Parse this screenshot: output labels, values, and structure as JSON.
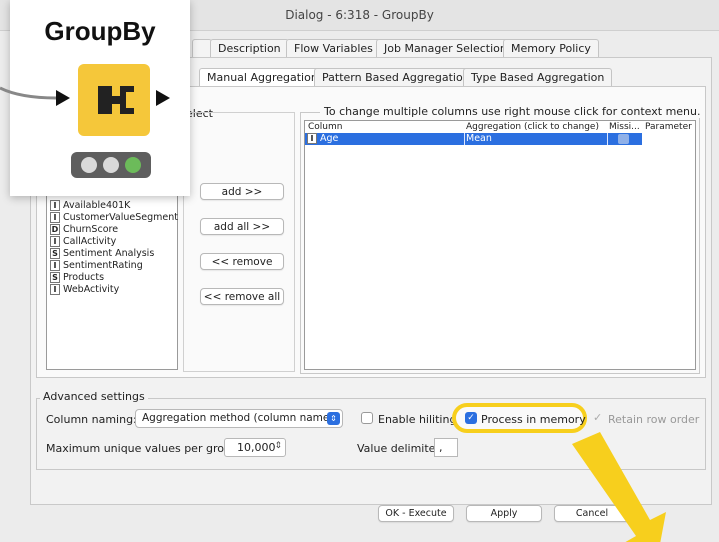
{
  "window": {
    "title": "Dialog - 6:318 - GroupBy"
  },
  "node": {
    "name": "GroupBy",
    "status_colors": [
      "#d9d9d9",
      "#d9d9d9",
      "#6cbb5a"
    ],
    "icon_color": "#f5c73a"
  },
  "tabs": [
    "Description",
    "Flow Variables",
    "Job Manager Selection",
    "Memory Policy"
  ],
  "subtabs": [
    "Manual Aggregation",
    "Pattern Based Aggregation",
    "Type Based Aggregation"
  ],
  "left_panel": {
    "legend_fragment": "elect",
    "columns": [
      {
        "type": "I",
        "name": "Available401K"
      },
      {
        "type": "I",
        "name": "CustomerValueSegment"
      },
      {
        "type": "D",
        "name": "ChurnScore"
      },
      {
        "type": "I",
        "name": "CallActivity"
      },
      {
        "type": "S",
        "name": "Sentiment Analysis"
      },
      {
        "type": "I",
        "name": "SentimentRating"
      },
      {
        "type": "S",
        "name": "Products"
      },
      {
        "type": "I",
        "name": "WebActivity"
      }
    ]
  },
  "buttons": {
    "add": "add >>",
    "add_all": "add all >>",
    "remove": "<< remove",
    "remove_all": "<< remove all"
  },
  "agg_table": {
    "legend": "To change multiple columns use right mouse click for context menu.",
    "headers": {
      "column": "Column",
      "aggregation": "Aggregation (click to change)",
      "missing": "Missi...",
      "parameter": "Parameter"
    },
    "row": {
      "type": "I",
      "column": "Age",
      "aggregation": "Mean"
    }
  },
  "advanced": {
    "legend": "Advanced settings",
    "column_naming_label": "Column naming:",
    "column_naming_value": "Aggregation method (column name)",
    "enable_hiliting": "Enable hiliting",
    "process_in_memory": "Process in memory",
    "retain_row_order": "Retain row order",
    "max_unique_label": "Maximum unique values per group",
    "max_unique_value": "10,000",
    "value_delimiter_label": "Value delimiter",
    "value_delimiter_value": ","
  },
  "footer": {
    "ok_execute": "OK - Execute",
    "apply": "Apply",
    "cancel": "Cancel"
  },
  "highlight_color": "#f7cf1d",
  "accent_color": "#2b6fe0"
}
